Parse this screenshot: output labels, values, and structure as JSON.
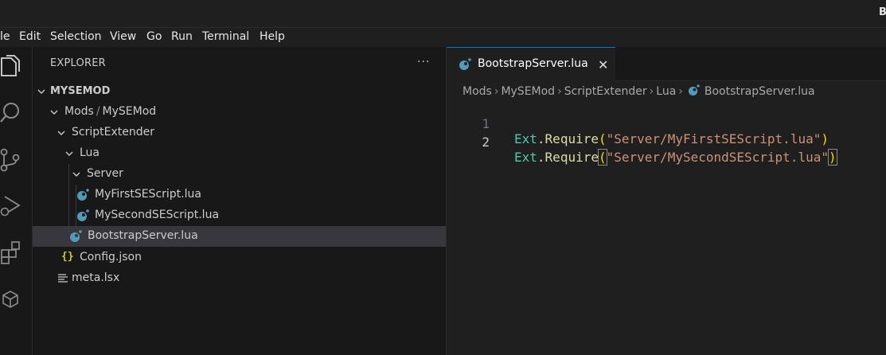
{
  "window": {
    "title": "B"
  },
  "menu": [
    "le",
    "Edit",
    "Selection",
    "View",
    "Go",
    "Run",
    "Terminal",
    "Help"
  ],
  "activity_bar": [
    {
      "icon": "files-icon"
    },
    {
      "icon": "search-icon"
    },
    {
      "icon": "source-control-icon"
    },
    {
      "icon": "run-debug-icon"
    },
    {
      "icon": "extensions-icon"
    },
    {
      "icon": "package-icon"
    }
  ],
  "sidebar": {
    "title": "EXPLORER",
    "more": "···",
    "root": "MYSEMOD",
    "tree": [
      {
        "label": "Mods",
        "type": "folder",
        "depth": 1,
        "expanded": true,
        "sub": "MySEMod"
      },
      {
        "label": "ScriptExtender",
        "type": "folder",
        "depth": 2,
        "expanded": true
      },
      {
        "label": "Lua",
        "type": "folder",
        "depth": 3,
        "expanded": true
      },
      {
        "label": "Server",
        "type": "folder",
        "depth": 4,
        "expanded": true
      },
      {
        "label": "MyFirstSEScript.lua",
        "type": "lua",
        "depth": 5
      },
      {
        "label": "MySecondSEScript.lua",
        "type": "lua",
        "depth": 5
      },
      {
        "label": "BootstrapServer.lua",
        "type": "lua",
        "depth": 4,
        "selected": true
      },
      {
        "label": "Config.json",
        "type": "json",
        "depth": 3,
        "icon_text": "{}"
      },
      {
        "label": "meta.lsx",
        "type": "lsx",
        "depth": 2
      }
    ]
  },
  "editor": {
    "tab": {
      "label": "BootstrapServer.lua",
      "close": "✕"
    },
    "breadcrumb": [
      "Mods",
      "MySEMod",
      "ScriptExtender",
      "Lua",
      "BootstrapServer.lua"
    ],
    "lines": [
      {
        "num": "1",
        "obj": "Ext",
        "dot": ".",
        "fn": "Require",
        "open": "(",
        "str": "\"Server/MyFirstSEScript.lua\"",
        "close": ")"
      },
      {
        "num": "2",
        "obj": "Ext",
        "dot": ".",
        "fn": "Require",
        "open": "(",
        "str": "\"Server/MySecondSEScript.lua\"",
        "close": ")"
      }
    ]
  },
  "colors": {
    "accent": "#0078d4",
    "lua_icon": "#519aba",
    "json_icon": "#cbcb41"
  }
}
